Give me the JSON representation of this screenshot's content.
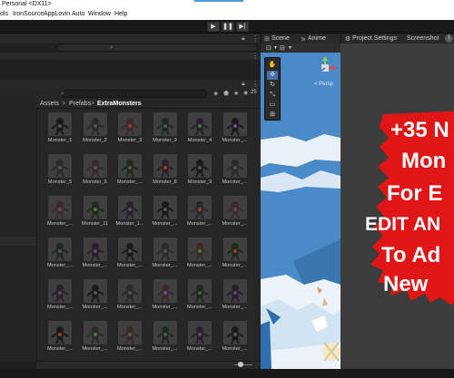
{
  "window": {
    "title": "Personal <DX11>"
  },
  "menu": [
    "ols",
    "IronSource",
    "AppLovin",
    "Auto",
    "Window",
    "Help"
  ],
  "play_controls": [
    {
      "name": "play-button",
      "icon": "▶"
    },
    {
      "name": "pause-button",
      "icon": "❚❚"
    },
    {
      "name": "step-button",
      "icon": "▶|"
    }
  ],
  "scene_tabs": [
    {
      "name": "tab-scene",
      "label": "Scene",
      "icon": "grid-icon"
    },
    {
      "name": "tab-animator",
      "label": "Anime",
      "icon": "animator-icon"
    }
  ],
  "inspector_tabs": [
    {
      "name": "tab-project-settings",
      "label": "Project Settings",
      "icon": "gear-icon"
    },
    {
      "name": "tab-screenshot",
      "label": "Screenshot",
      "icon": ""
    }
  ],
  "scene": {
    "persp_label": "< Persp"
  },
  "project": {
    "breadcrumb": [
      "Assets",
      "Prefabs",
      "ExtraMonsters"
    ],
    "breadcrumb_sep": ">",
    "hidden_count": "25"
  },
  "assets": [
    "Monster_1",
    "Monster_2",
    "Monster_3",
    "Monster_3",
    "Monster_4",
    "Monster_...",
    "Monster_5",
    "Monster_6",
    "Monster_...",
    "Monster_8",
    "Monster_9",
    "Monster_...",
    "Monster_...",
    "Monster_11",
    "Monster_1...",
    "Monster_...",
    "Monster_...",
    "Monster_...",
    "Monster_...",
    "Monster_...",
    "Monster_...",
    "Monster_...",
    "Monster_...",
    "Monster_...",
    "Monster_...",
    "Monster_...",
    "Monster_...",
    "Monster_...",
    "Monster_...",
    "Monster_...",
    "Monster_...",
    "Monster_...",
    "Monster_...",
    "Monster_...",
    "Monster_...",
    "Monster_..."
  ],
  "promo": {
    "line1": "+35 N",
    "line2": "Mon",
    "line3": "For E",
    "line4": "EDIT AN",
    "line5": "To Ad",
    "line6": "New"
  },
  "colors": {
    "promo_red": "#e01515",
    "scene_sky": "#4a89c6",
    "accent_blue": "#4a9de0"
  }
}
